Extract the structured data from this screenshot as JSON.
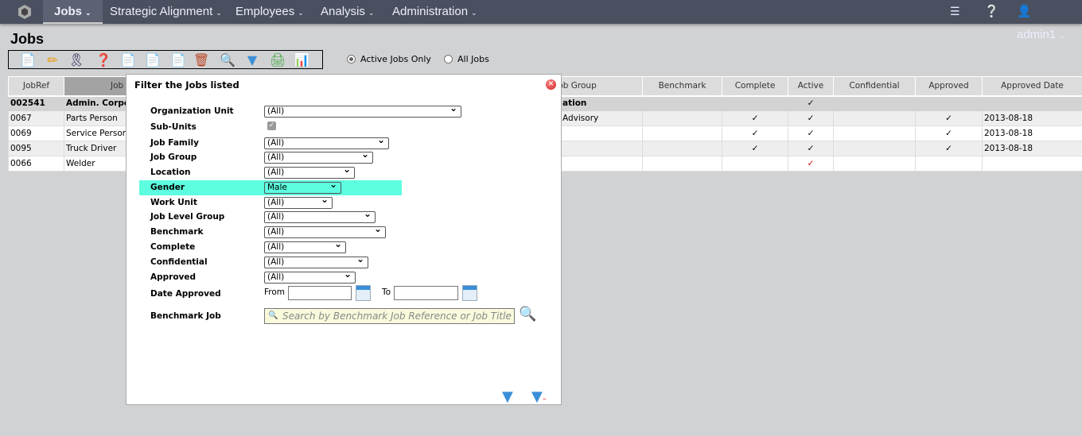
{
  "nav": {
    "items": [
      {
        "label": "Jobs",
        "active": true
      },
      {
        "label": "Strategic Alignment"
      },
      {
        "label": "Employees"
      },
      {
        "label": "Analysis"
      },
      {
        "label": "Administration"
      }
    ],
    "user": "admin1"
  },
  "page": {
    "title": "Jobs"
  },
  "toolbar": {
    "icons": [
      "new-job-icon",
      "edit-icon",
      "award-icon",
      "job-help-icon",
      "copy-icon",
      "move-icon",
      "transfer-icon",
      "delete-icon",
      "search-icon",
      "filter-icon",
      "print-icon",
      "reports-icon"
    ]
  },
  "view": {
    "options": [
      {
        "label": "Active Jobs Only",
        "selected": true
      },
      {
        "label": "All Jobs",
        "selected": false
      }
    ]
  },
  "table": {
    "headers": [
      "JobRef",
      "Job",
      "Job Group",
      "Benchmark",
      "Complete",
      "Active",
      "Confidential",
      "Approved",
      "Approved Date"
    ],
    "rows": [
      {
        "ref": "002541",
        "title": "Admin. Corpo",
        "group": "ation",
        "complete": "",
        "active": "✓",
        "approved": "",
        "date": "",
        "type": "group"
      },
      {
        "ref": "0067",
        "title": "Parts Person",
        "group": "Advisory",
        "complete": "✓",
        "active": "✓",
        "approved": "✓",
        "date": "2013-08-18",
        "type": "alt"
      },
      {
        "ref": "0069",
        "title": "Service Person",
        "group": "",
        "complete": "✓",
        "active": "✓",
        "approved": "✓",
        "date": "2013-08-18",
        "type": "plain"
      },
      {
        "ref": "0095",
        "title": "Truck Driver",
        "group": "",
        "complete": "✓",
        "active": "✓",
        "approved": "✓",
        "date": "2013-08-18",
        "type": "alt"
      },
      {
        "ref": "0066",
        "title": "Welder",
        "group": "",
        "complete": "",
        "active": "✓",
        "approved": "",
        "date": "",
        "type": "plain"
      }
    ]
  },
  "filter": {
    "title": "Filter the Jobs listed",
    "fields": {
      "org_unit": {
        "label": "Organization Unit",
        "value": "(All)"
      },
      "sub_units": {
        "label": "Sub-Units",
        "checked": true
      },
      "job_family": {
        "label": "Job Family",
        "value": "(All)"
      },
      "job_group": {
        "label": "Job Group",
        "value": "(All)"
      },
      "location": {
        "label": "Location",
        "value": "(All)"
      },
      "gender": {
        "label": "Gender",
        "value": "Male"
      },
      "work_unit": {
        "label": "Work Unit",
        "value": "(All)"
      },
      "job_level_group": {
        "label": "Job Level Group",
        "value": "(All)"
      },
      "benchmark": {
        "label": "Benchmark",
        "value": "(All)"
      },
      "complete": {
        "label": "Complete",
        "value": "(All)"
      },
      "confidential": {
        "label": "Confidential",
        "value": "(All)"
      },
      "approved": {
        "label": "Approved",
        "value": "(All)"
      },
      "date_approved": {
        "label": "Date Approved",
        "from_label": "From",
        "to_label": "To",
        "from": "",
        "to": ""
      },
      "benchmark_job": {
        "label": "Benchmark Job",
        "placeholder": "Search by Benchmark Job Reference or Job Title"
      }
    },
    "highlight_color": "#5dfde0"
  }
}
